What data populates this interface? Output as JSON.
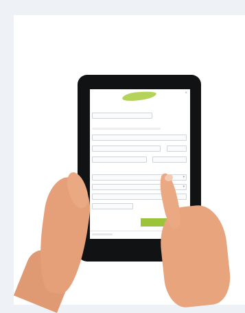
{
  "image": {
    "description_free": true
  },
  "form": {
    "close_icon": "close-icon",
    "section1_title": "",
    "section2_title": "",
    "section3_title": "",
    "submit_label": "",
    "accent_color": "#9cc43a"
  }
}
